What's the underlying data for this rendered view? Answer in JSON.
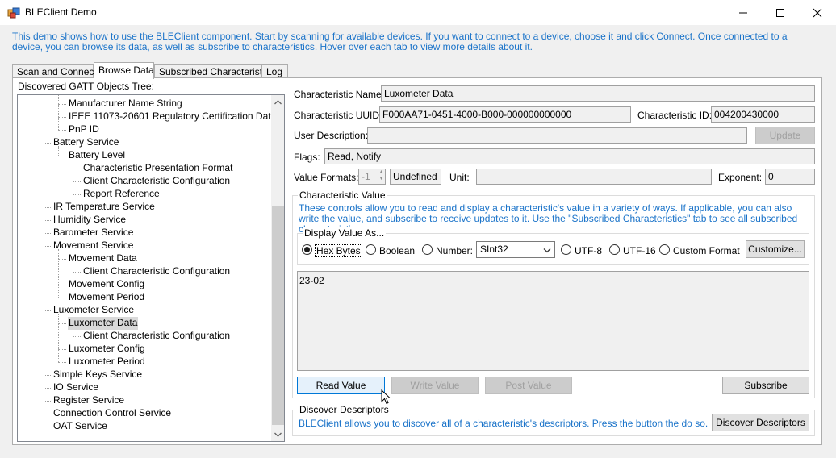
{
  "window": {
    "title": "BLEClient Demo",
    "minimize_glyph": "—",
    "maximize_glyph": "☐",
    "close_glyph": "✕"
  },
  "intro_text": "This demo shows how to use the BLEClient component. Start by scanning for available devices. If you want to connect to a device, choose it and click Connect. Once connected to a device, you can browse its data, as well as subscribe to characteristics. Hover over each tab to view more details about it.",
  "tabs": [
    {
      "label": "Scan and Connect"
    },
    {
      "label": "Browse Data"
    },
    {
      "label": "Subscribed Characteristics"
    },
    {
      "label": "Log"
    }
  ],
  "tree": {
    "label": "Discovered GATT Objects Tree:",
    "items": [
      {
        "label": "Manufacturer Name String",
        "level": 2
      },
      {
        "label": "IEEE 11073-20601 Regulatory Certification Data List",
        "level": 2
      },
      {
        "label": "PnP ID",
        "level": 2
      },
      {
        "label": "Battery Service",
        "level": 1
      },
      {
        "label": "Battery Level",
        "level": 2
      },
      {
        "label": "Characteristic Presentation Format",
        "level": 3
      },
      {
        "label": "Client Characteristic Configuration",
        "level": 3
      },
      {
        "label": "Report Reference",
        "level": 3
      },
      {
        "label": "IR Temperature Service",
        "level": 1
      },
      {
        "label": "Humidity Service",
        "level": 1
      },
      {
        "label": "Barometer Service",
        "level": 1
      },
      {
        "label": "Movement Service",
        "level": 1
      },
      {
        "label": "Movement Data",
        "level": 2
      },
      {
        "label": "Client Characteristic Configuration",
        "level": 3
      },
      {
        "label": "Movement Config",
        "level": 2
      },
      {
        "label": "Movement Period",
        "level": 2
      },
      {
        "label": "Luxometer Service",
        "level": 1
      },
      {
        "label": "Luxometer Data",
        "level": 2,
        "selected": true
      },
      {
        "label": "Client Characteristic Configuration",
        "level": 3
      },
      {
        "label": "Luxometer Config",
        "level": 2
      },
      {
        "label": "Luxometer Period",
        "level": 2
      },
      {
        "label": "Simple Keys Service",
        "level": 1
      },
      {
        "label": "IO Service",
        "level": 1
      },
      {
        "label": "Register Service",
        "level": 1
      },
      {
        "label": "Connection Control Service",
        "level": 1
      },
      {
        "label": "OAT Service",
        "level": 1
      }
    ],
    "scroll_up_glyph": "︿",
    "scroll_down_glyph": "﹀"
  },
  "details": {
    "name_label": "Characteristic Name:",
    "name_value": "Luxometer Data",
    "uuid_label": "Characteristic UUID:",
    "uuid_value": "F000AA71-0451-4000-B000-000000000000",
    "id_label": "Characteristic ID:",
    "id_value": "004200430000",
    "desc_label": "User Description:",
    "desc_value": "",
    "update_label": "Update",
    "flags_label": "Flags:",
    "flags_value": "Read, Notify",
    "formats_label": "Value Formats:",
    "formats_index": "-1",
    "formats_value": "Undefined",
    "unit_label": "Unit:",
    "unit_value": "",
    "exponent_label": "Exponent:",
    "exponent_value": "0"
  },
  "char_value": {
    "title": "Characteristic Value",
    "help": "These controls allow you to read and display a characteristic's value in a variety of ways. If applicable, you can also write the value, and subscribe to receive updates to it. Use the \"Subscribed Characteristics\" tab to see all subscribed characteristics.",
    "display_title": "Display Value As...",
    "options": {
      "hex": "Hex Bytes",
      "boolean": "Boolean",
      "number": "Number:",
      "utf8": "UTF-8",
      "utf16": "UTF-16",
      "custom": "Custom Format"
    },
    "number_type": "SInt32",
    "customize_label": "Customize...",
    "value_text": "23-02",
    "read_label": "Read Value",
    "write_label": "Write Value",
    "post_label": "Post Value",
    "subscribe_label": "Subscribe"
  },
  "descriptors": {
    "title": "Discover Descriptors",
    "help": "BLEClient allows you to discover all of a characteristic's descriptors. Press the button the do so.",
    "button_label": "Discover Descriptors"
  }
}
